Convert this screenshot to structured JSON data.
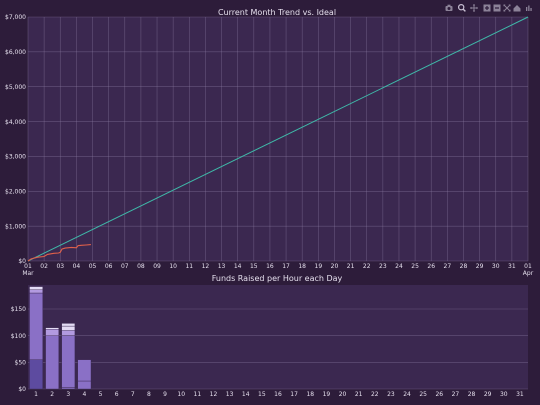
{
  "toolbar": {
    "items": [
      "camera-icon",
      "zoom-icon",
      "pan-icon",
      "zoom-in-icon",
      "zoom-out-icon",
      "autoscale-icon",
      "reset-icon",
      "plotly-logo-icon"
    ]
  },
  "chart_data": [
    {
      "type": "line",
      "title": "Current Month Trend vs. Ideal",
      "xlabel": "",
      "ylabel": "",
      "x_ticks": [
        "01\nMar",
        "02",
        "03",
        "04",
        "05",
        "06",
        "07",
        "08",
        "09",
        "10",
        "11",
        "12",
        "13",
        "14",
        "15",
        "16",
        "17",
        "18",
        "19",
        "20",
        "21",
        "22",
        "23",
        "24",
        "25",
        "26",
        "27",
        "28",
        "29",
        "30",
        "31",
        "01\nApr"
      ],
      "y_ticks": [
        "$0",
        "$1,000",
        "$2,000",
        "$3,000",
        "$4,000",
        "$5,000",
        "$6,000",
        "$7,000"
      ],
      "xlim": [
        0,
        31
      ],
      "ylim": [
        0,
        7000
      ],
      "grid": true,
      "colors": {
        "ideal": "#3fb8a8",
        "actual": "#e0604a",
        "grid": "#8a7aa0",
        "plot_bg": "#3b2850",
        "text": "#e6e0ee"
      },
      "series": [
        {
          "key": "ideal",
          "x": [
            0,
            31
          ],
          "y": [
            0,
            7000
          ]
        },
        {
          "key": "actual",
          "x": [
            0,
            0.2,
            0.6,
            1.0,
            1.2,
            1.6,
            1.9,
            2.0,
            2.1,
            2.3,
            2.7,
            3.0,
            3.1,
            3.3,
            3.6,
            3.9
          ],
          "y": [
            0,
            60,
            110,
            130,
            190,
            220,
            230,
            250,
            340,
            370,
            390,
            380,
            440,
            450,
            460,
            470
          ]
        }
      ]
    },
    {
      "type": "bar",
      "stacked": true,
      "title": "Funds Raised per Hour each Day",
      "xlabel": "",
      "ylabel": "",
      "categories": [
        "1",
        "2",
        "3",
        "4",
        "5",
        "6",
        "7",
        "8",
        "9",
        "10",
        "11",
        "12",
        "13",
        "14",
        "15",
        "16",
        "17",
        "18",
        "19",
        "20",
        "21",
        "22",
        "23",
        "24",
        "25",
        "26",
        "27",
        "28",
        "29",
        "30",
        "31"
      ],
      "y_ticks": [
        "$0",
        "$50",
        "$100",
        "$150"
      ],
      "ylim": [
        0,
        195
      ],
      "grid": true,
      "colors": {
        "segments": [
          "#5d4ba0",
          "#8a70c6",
          "#b29ae0",
          "#e4dcf5"
        ],
        "grid": "#8a7aa0",
        "plot_bg": "#3b2850",
        "text": "#e6e0ee"
      },
      "segments": [
        {
          "category": "1",
          "from": 0,
          "to": 55,
          "shade": 0
        },
        {
          "category": "1",
          "from": 55,
          "to": 180,
          "shade": 1
        },
        {
          "category": "1",
          "from": 180,
          "to": 186,
          "shade": 2
        },
        {
          "category": "1",
          "from": 186,
          "to": 192,
          "shade": 3
        },
        {
          "category": "2",
          "from": 0,
          "to": 100,
          "shade": 1
        },
        {
          "category": "2",
          "from": 100,
          "to": 112,
          "shade": 2
        },
        {
          "category": "2",
          "from": 112,
          "to": 115,
          "shade": 3
        },
        {
          "category": "3",
          "from": 0,
          "to": 3,
          "shade": 1
        },
        {
          "category": "3",
          "from": 3,
          "to": 100,
          "shade": 1
        },
        {
          "category": "3",
          "from": 100,
          "to": 110,
          "shade": 2
        },
        {
          "category": "3",
          "from": 110,
          "to": 118,
          "shade": 3
        },
        {
          "category": "3",
          "from": 118,
          "to": 123,
          "shade": 3
        },
        {
          "category": "4",
          "from": 0,
          "to": 15,
          "shade": 1
        },
        {
          "category": "4",
          "from": 15,
          "to": 55,
          "shade": 1
        }
      ]
    }
  ]
}
